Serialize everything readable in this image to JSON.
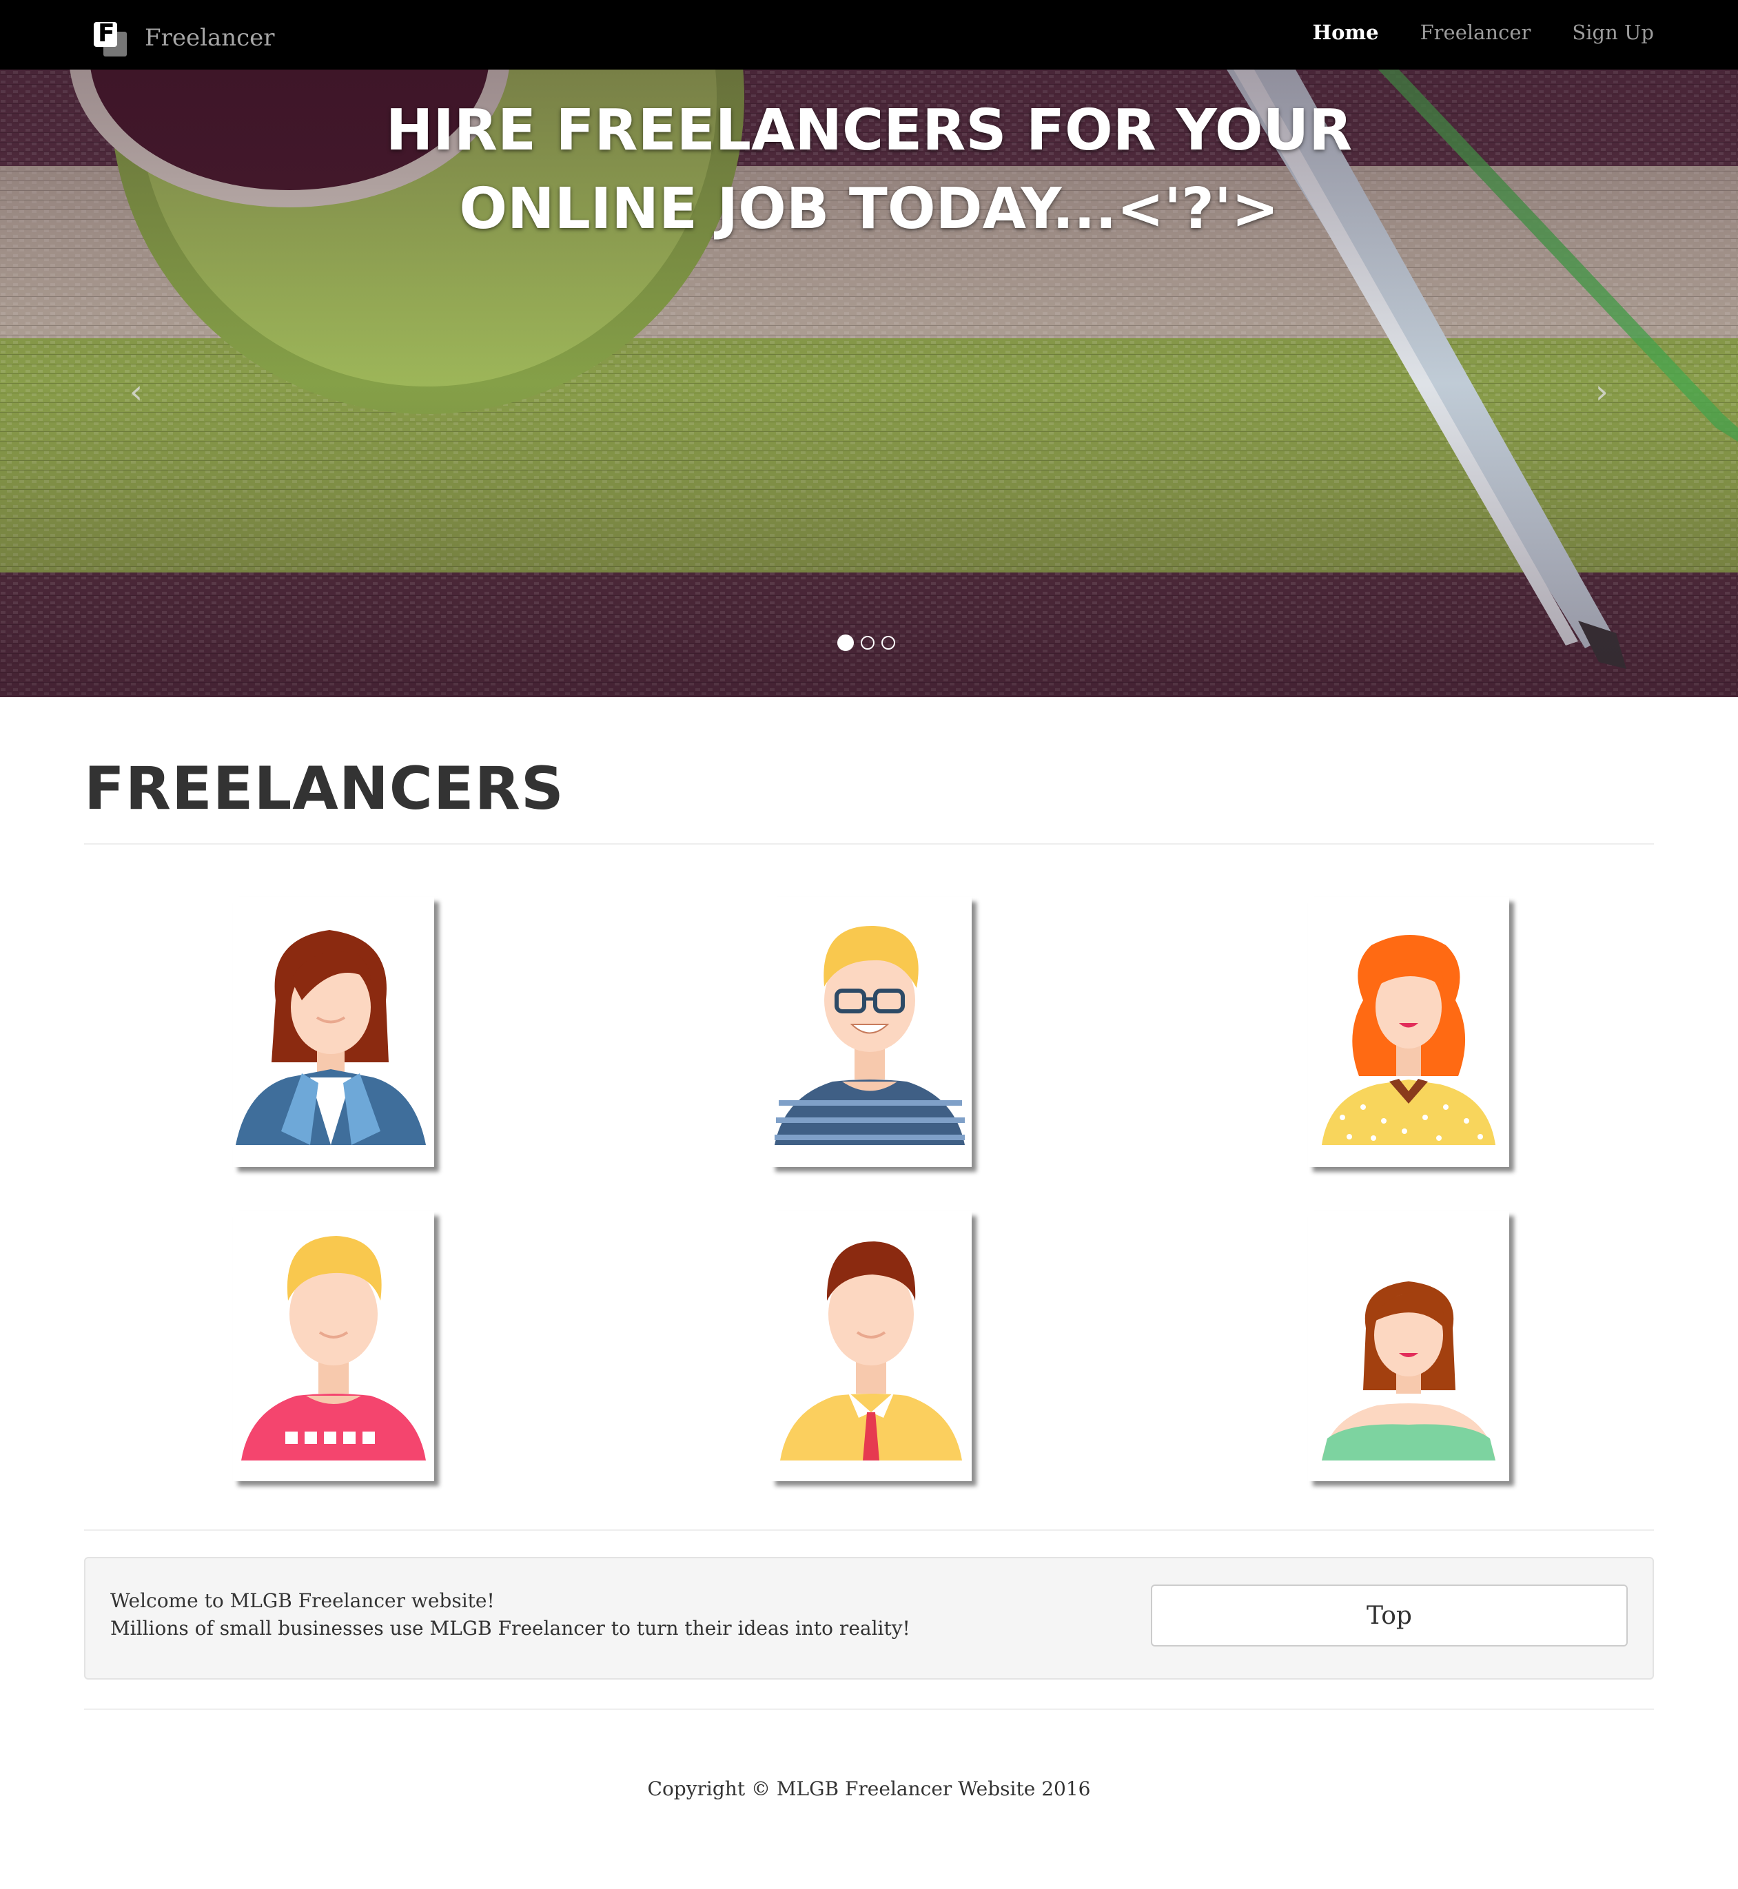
{
  "navbar": {
    "brand": "Freelancer",
    "links": [
      {
        "label": "Home",
        "active": true
      },
      {
        "label": "Freelancer",
        "active": false
      },
      {
        "label": "Sign Up",
        "active": false
      }
    ]
  },
  "carousel": {
    "title": "HIRE FREELANCERS FOR YOUR\nONLINE JOB TODAY...<'?'>",
    "prev_icon": "chevron-left-icon",
    "next_icon": "chevron-right-icon",
    "slide_count": 3,
    "active_slide": 1
  },
  "freelancers": {
    "title": "FREELANCERS",
    "avatars": [
      {
        "name": "woman-blazer-avatar"
      },
      {
        "name": "man-glasses-avatar"
      },
      {
        "name": "redhead-woman-avatar"
      },
      {
        "name": "blonde-man-avatar"
      },
      {
        "name": "man-tie-avatar"
      },
      {
        "name": "woman-bob-avatar"
      }
    ]
  },
  "well": {
    "line1": "Welcome to MLGB Freelancer website!",
    "line2": "Millions of small businesses use MLGB Freelancer to turn their ideas into reality!",
    "top_button": "Top"
  },
  "footer": {
    "copyright": "Copyright © MLGB Freelancer Website 2016"
  },
  "colors": {
    "navbar_bg": "#000000",
    "heading": "#333333",
    "well_bg": "#f5f5f5"
  }
}
